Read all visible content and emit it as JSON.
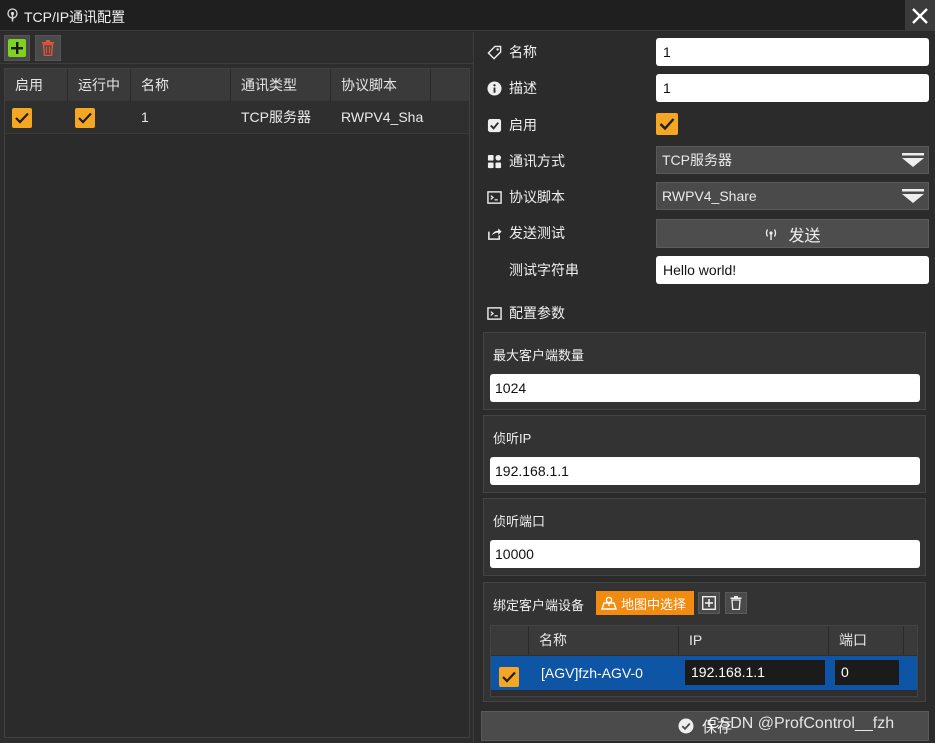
{
  "window": {
    "title": "TCP/IP通讯配置",
    "app_icon": "broadcast-icon",
    "close_icon": "close-icon"
  },
  "toolbar": {
    "add_icon": "add-icon",
    "delete_icon": "trash-icon"
  },
  "grid": {
    "headers": [
      "启用",
      "运行中",
      "名称",
      "通讯类型",
      "协议脚本"
    ],
    "rows": [
      {
        "enabled": true,
        "running": true,
        "name": "1",
        "type": "TCP服务器",
        "script": "RWPV4_Sha"
      }
    ]
  },
  "form": {
    "name": {
      "label": "名称",
      "value": "1",
      "icon": "tag-icon"
    },
    "description": {
      "label": "描述",
      "value": "1",
      "icon": "info-icon"
    },
    "enabled": {
      "label": "启用",
      "checked": true,
      "icon": "checkbox-icon"
    },
    "comm_mode": {
      "label": "通讯方式",
      "value": "TCP服务器",
      "icon": "grid-icon"
    },
    "protocol_script": {
      "label": "协议脚本",
      "value": "RWPV4_Share",
      "icon": "terminal-icon"
    },
    "send_test": {
      "label": "发送测试",
      "button": "发送",
      "icon": "share-icon"
    },
    "test_string": {
      "label": "测试字符串",
      "value": "Hello world!"
    },
    "config_params": {
      "label": "配置参数",
      "icon": "terminal-icon"
    }
  },
  "params": {
    "max_clients": {
      "label": "最大客户端数量",
      "value": "1024"
    },
    "listen_ip": {
      "label": "侦听IP",
      "value": "192.168.1.1"
    },
    "listen_port": {
      "label": "侦听端口",
      "value": "10000"
    }
  },
  "bind": {
    "label": "绑定客户端设备",
    "map_button": "地图中选择",
    "headers": [
      "名称",
      "IP",
      "端口"
    ],
    "rows": [
      {
        "checked": true,
        "name": "[AGV]fzh-AGV-0",
        "ip": "192.168.1.1",
        "port": "0"
      }
    ]
  },
  "save": {
    "label": "保存"
  },
  "watermark": "CSDN @ProfControl__fzh",
  "colors": {
    "accent": "#f5a623",
    "map_button": "#f28c10",
    "selected_row": "#0f55a6",
    "add_green": "#7ed321",
    "delete_red": "#e0563a"
  }
}
